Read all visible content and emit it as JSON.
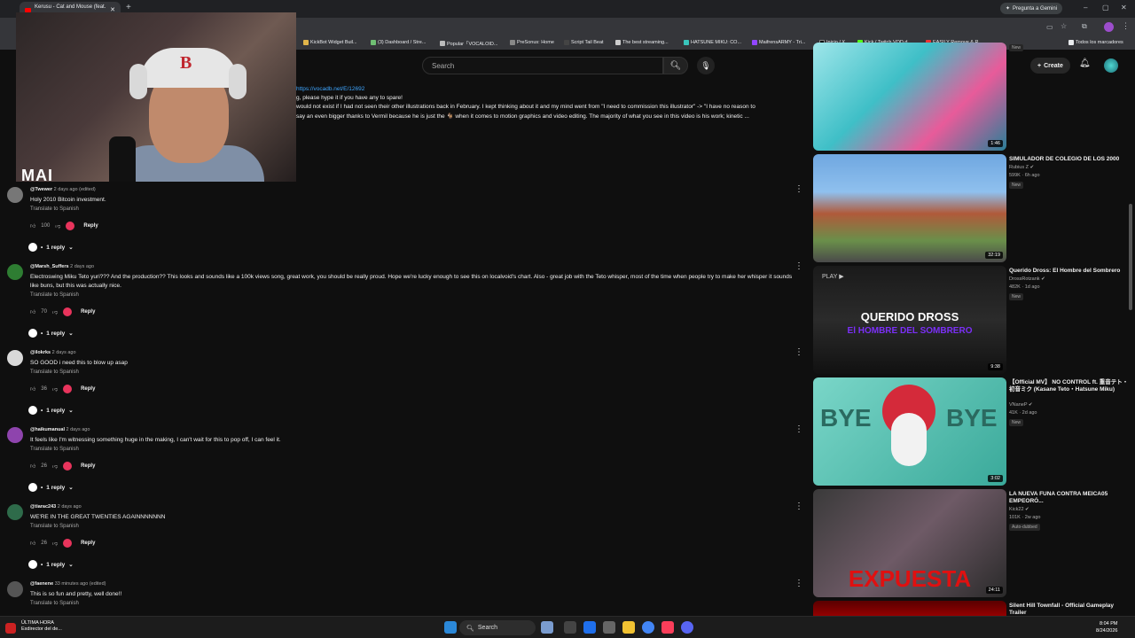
{
  "browser": {
    "tab_title": "Kerusu - Cat and Mouse (feat. ...",
    "gemini_label": "Pregunta a Gemini",
    "bookmarks": [
      "KickBot Widget Buil...",
      "(3) Dashboard / Stre...",
      "Popular「VOCALOID...",
      "PreSonus: Home",
      "Script Tail Beat",
      "The best streaming...",
      "HATSUNE MIKU: CO...",
      "MaifrensARMY - Tri...",
      "Inicio / X",
      "Kick / Twitch VOD d...",
      "EASILY Remove & R...",
      "Todos los marcadores"
    ]
  },
  "youtube": {
    "search_placeholder": "Search",
    "create_label": "Create"
  },
  "webcam": {
    "overlay_text": "MAI"
  },
  "description": {
    "link": "https://vocadb.net/E/12692",
    "line1": "g, please hype it if you have any to spare!",
    "line2": "would not exist if I had not seen their other illustrations back in February. I kept thinking about it and my mind went from \"I need to commission this illustrator\" -> \"I have no reason to",
    "line3": "say an even bigger thanks to Vermil because he is just the 🐐 when it comes to motion graphics and video editing. The majority of what you see in this video is his work; kinetic ..."
  },
  "comments": [
    {
      "author": "@Twewer",
      "time": "2 days ago (edited)",
      "text": "Holy 2010 Bitcoin investment.",
      "translate": "Translate to Spanish",
      "likes": "100",
      "reply": "Reply",
      "replies": "1 reply",
      "avatar_color": "#777777"
    },
    {
      "author": "@Marsh_Suffers",
      "time": "2 days ago",
      "text": "Electroswing Miku Teto yuri??? And the production?? This looks and sounds like a 100k views song, great work, you should be really proud. Hope we're lucky enough to see this on localvoid's chart. Also - great job with the Teto whisper, most of the time when people try to make her whisper it sounds like buns, but this was actually nice.",
      "translate": "Translate to Spanish",
      "likes": "70",
      "reply": "Reply",
      "replies": "1 reply",
      "avatar_color": "#2e7d32"
    },
    {
      "author": "@ilokrks",
      "time": "2 days ago",
      "text": "SO GOOD i need this to blow up asap",
      "translate": "Translate to Spanish",
      "likes": "36",
      "reply": "Reply",
      "replies": "1 reply",
      "avatar_color": "#d9d9d9"
    },
    {
      "author": "@haikumanual",
      "time": "2 days ago",
      "text": "It feels like I'm witnessing something huge in the making, I can't wait for this to pop off, I can feel it.",
      "translate": "Translate to Spanish",
      "likes": "26",
      "reply": "Reply",
      "replies": "1 reply",
      "avatar_color": "#8e44ad"
    },
    {
      "author": "@tiarac243",
      "time": "2 days ago",
      "text": "WE'RE IN THE GREAT TWENTIES AGAINNNNNNN",
      "translate": "Translate to Spanish",
      "likes": "26",
      "reply": "Reply",
      "replies": "1 reply",
      "avatar_color": "#2e6b4a"
    },
    {
      "author": "@faenene",
      "time": "33 minutes ago (edited)",
      "text": "This is so fun and pretty, well done!!",
      "translate": "Translate to Spanish",
      "likes": "",
      "reply": "",
      "replies": "",
      "avatar_color": "#555555"
    }
  ],
  "sidebar": [
    {
      "title": "",
      "channel": "",
      "meta": "",
      "badge": "New",
      "duration": "1:46",
      "thumb": "linear-gradient(135deg,#9fe6ea,#3fbfc7 40%,#e85b9a 70%,#2a7f99)"
    },
    {
      "title": "SIMULADOR DE COLEGIO DE LOS 2000",
      "channel": "Rubius Z",
      "meta": "599K · 6h ago",
      "badge": "New",
      "duration": "32:19",
      "thumb": "linear-gradient(180deg,#6fa7e0 0%,#8fc0ee 35%,#b05a3a 55%,#6a8f4a 80%,#4a4a4a)"
    },
    {
      "title": "Querido Dross: El Hombre del Sombrero",
      "channel": "DrossRotzank",
      "meta": "482K · 1d ago",
      "badge": "New",
      "duration": "9:38",
      "thumb": "linear-gradient(180deg,#1a1a1a,#2b2b2b 50%,#111)",
      "thumb_text1": "QUERIDO DROSS",
      "thumb_text2": "El HOMBRE DEL SOMBRERO",
      "thumb_play": "PLAY ▶"
    },
    {
      "title": "【Official MV】 NO CONTROL ft. 重音テト・初音ミク (Kasane Teto・Hatsune Miku)",
      "channel": "VNaneP",
      "meta": "41K · 2d ago",
      "badge": "New",
      "duration": "3:02",
      "thumb": "linear-gradient(135deg,#7ad6c8,#3aa99a)",
      "thumb_text1": "BYE",
      "thumb_text2": "BYE"
    },
    {
      "title": "LA NUEVA FUNA CONTRA MEICA05 EMPEORÓ...",
      "channel": "Kick22",
      "meta": "101K · 2w ago",
      "badge": "Auto-dubbed",
      "duration": "24:11",
      "thumb": "linear-gradient(135deg,#3a3a3a,#6e5a66 50%,#2a2a2a)",
      "thumb_text1": "EXPUESTA"
    },
    {
      "title": "Silent Hill Townfall - Official Gameplay Trailer",
      "channel": "",
      "meta": "",
      "badge": "",
      "duration": "",
      "thumb": "linear-gradient(180deg,#5a0000,#c00000)"
    }
  ],
  "taskbar": {
    "news_title": "ÚLTIMA HORA",
    "news_sub": "Exdirector del de...",
    "search": "Search",
    "time": "8:04 PM",
    "date": "8/24/2026"
  }
}
